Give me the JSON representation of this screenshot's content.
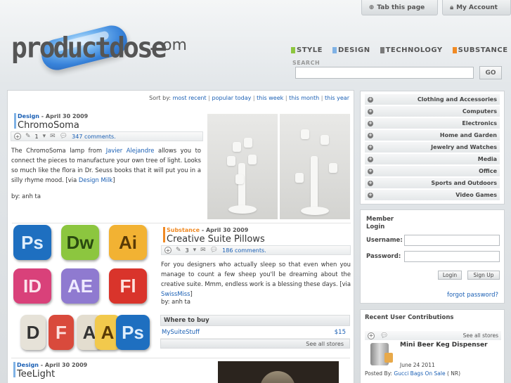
{
  "topbar": {
    "tab_label": "Tab this page",
    "account_label": "My Account"
  },
  "logo": {
    "word": "productdose",
    "tld": ".com"
  },
  "nav": {
    "categories": [
      {
        "label": "STYLE",
        "color": "#8dc63f"
      },
      {
        "label": "DESIGN",
        "color": "#7fb2e5"
      },
      {
        "label": "TECHNOLOGY",
        "color": "#7a7a7a"
      },
      {
        "label": "SUBSTANCE",
        "color": "#f08a24"
      }
    ]
  },
  "search": {
    "label": "SEARCH",
    "value": "",
    "button": "GO"
  },
  "sort": {
    "prefix": "Sort by:",
    "options": [
      "most recent",
      "popular today",
      "this week",
      "this month",
      "this year"
    ]
  },
  "posts": [
    {
      "category": "Design",
      "date": "April 30 2009",
      "title": "ChromoSoma",
      "bar_color": "#7fb2e5",
      "vote_count": "1",
      "comments": "347 comments.",
      "text_before": "The ChromoSoma lamp from ",
      "link1": "Javier Alejandre",
      "text_mid": " allows you to connect the pieces to manufacture your own tree of light. Looks so much like the flora in Dr. Seuss books that it will put you in a silly rhyme mood. [via ",
      "link2": "Design Milk",
      "text_after": "]",
      "byline": "by: anh ta"
    },
    {
      "category": "Substance",
      "date": "April 30 2009",
      "title": "Creative Suite Pillows",
      "bar_color": "#f08a24",
      "vote_count": "3",
      "comments": "186 comments.",
      "text_before": "For you designers who actually sleep so that even when you manage to count a few sheep you'll be dreaming about the creative suite. Mmm, endless work is a blessing these days. [via ",
      "link2": "SwissMiss",
      "text_after": "]",
      "byline": "by: anh ta",
      "pillows": [
        {
          "label": "Ps",
          "bg": "#1e6fc0",
          "fg": "#dfeefc"
        },
        {
          "label": "Dw",
          "bg": "#8cc63f",
          "fg": "#2a4a10"
        },
        {
          "label": "Ai",
          "bg": "#f2b233",
          "fg": "#5a3a06"
        },
        {
          "label": "ID",
          "bg": "#d9417a",
          "fg": "#fbe3ec"
        },
        {
          "label": "AE",
          "bg": "#8f7ad0",
          "fg": "#efeaff"
        },
        {
          "label": "Fl",
          "bg": "#d9342b",
          "fg": "#fde1de"
        },
        {
          "label": "D",
          "bg": "#e6e2d8",
          "fg": "#333333"
        },
        {
          "label": "F",
          "bg": "#d94a3c",
          "fg": "#fde1de"
        },
        {
          "label": "A",
          "bg": "#e3ddcf",
          "fg": "#333333"
        },
        {
          "label": "A",
          "bg": "#f2c94c",
          "fg": "#5a3a06"
        },
        {
          "label": "Ps",
          "bg": "#1e6fc0",
          "fg": "#dfeefc"
        }
      ],
      "where_to_buy": {
        "heading": "Where to buy",
        "store": "MySuiteStuff",
        "price": "$15",
        "see_all": "See all stores"
      }
    },
    {
      "category": "Design",
      "date": "April 30 2009",
      "title": "TeeLight",
      "bar_color": "#7fb2e5"
    }
  ],
  "sidebar": {
    "categories": [
      "Clothing and Accessories",
      "Computers",
      "Electronics",
      "Home and Garden",
      "Jewelry and Watches",
      "Media",
      "Office",
      "Sports and Outdoors",
      "Video Games"
    ],
    "login": {
      "title_line1": "Member",
      "title_line2": "Login",
      "username_label": "Username:",
      "password_label": "Password:",
      "login_button": "Login",
      "signup_button": "Sign Up",
      "forgot": "forgot password?"
    },
    "contributions": {
      "title": "Recent User Contributions",
      "see_all": "See all stores",
      "item_name": "Mini Beer Keg Dispenser",
      "item_date": "June 24 2011",
      "posted_by_prefix": "Posted By: ",
      "posted_by_link": "Gucci Bags On Sale",
      "posted_by_suffix": " ( NR)"
    }
  }
}
